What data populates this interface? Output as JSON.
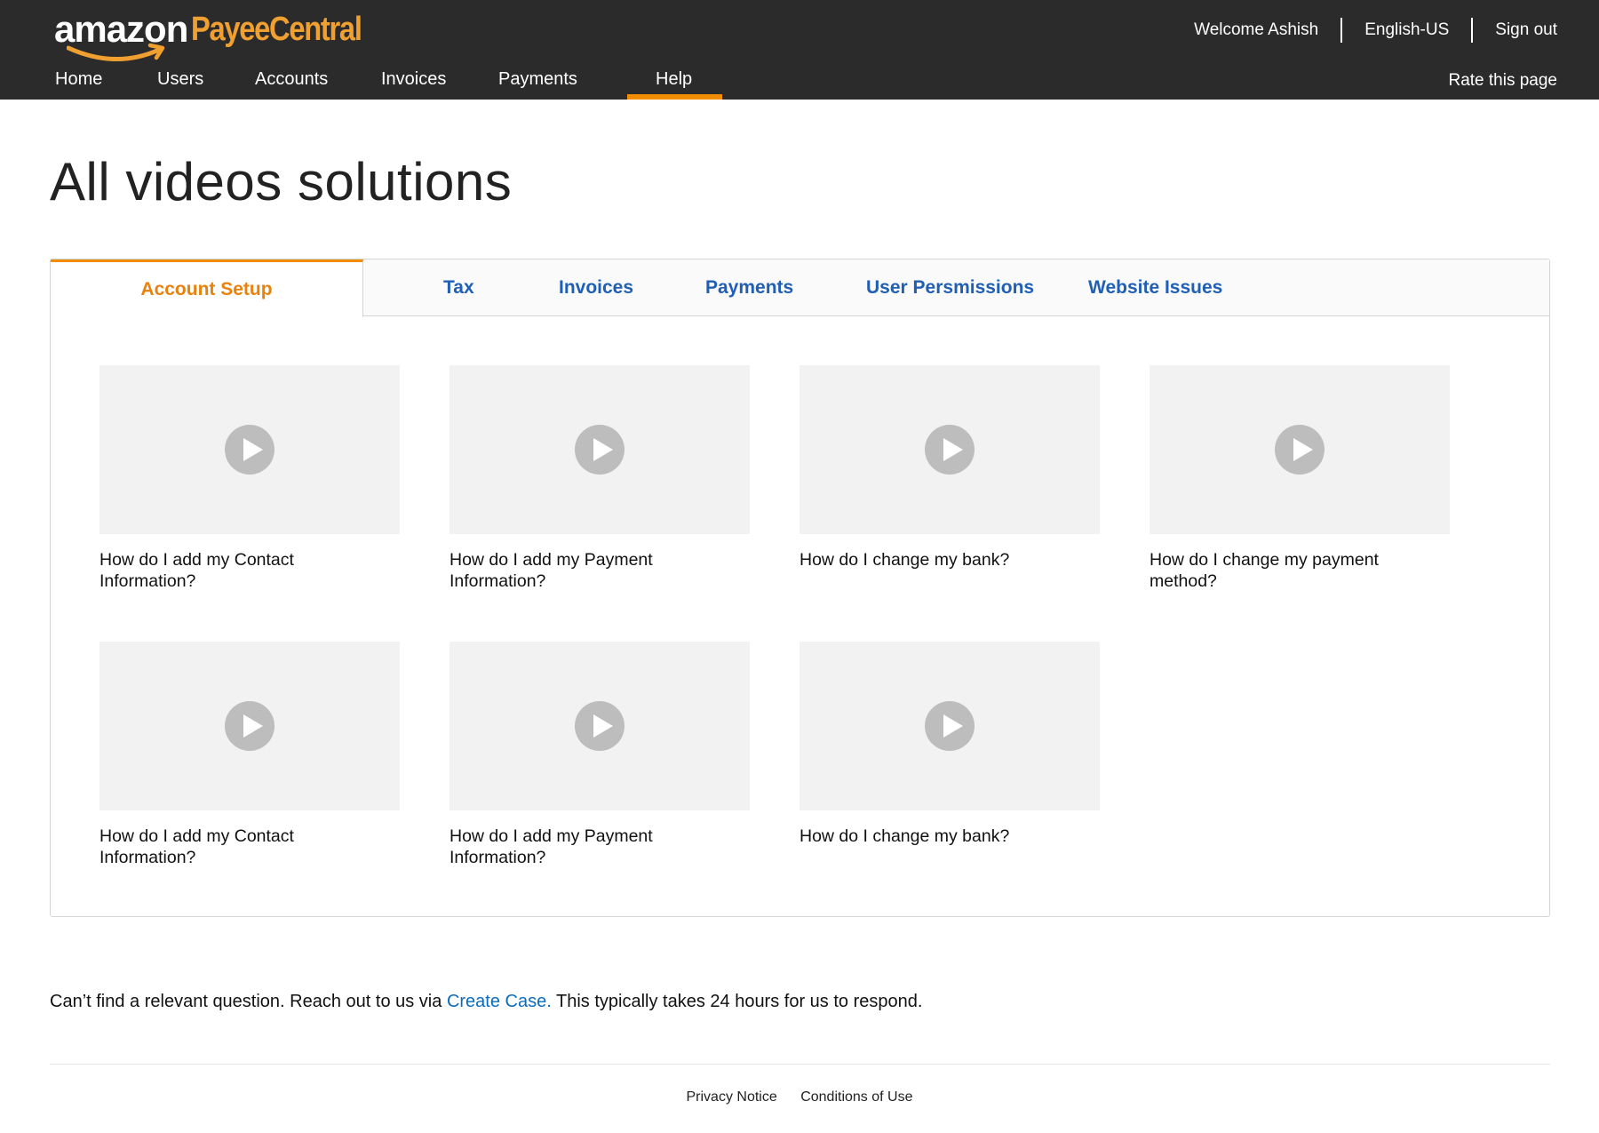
{
  "header": {
    "logo_primary": "amazon",
    "logo_secondary": "PayeeCentral",
    "welcome": "Welcome Ashish",
    "language": "English-US",
    "sign_out": "Sign out",
    "rate_page": "Rate this page"
  },
  "nav": {
    "items": [
      "Home",
      "Users",
      "Accounts",
      "Invoices",
      "Payments",
      "Help"
    ],
    "active": "Help"
  },
  "page": {
    "title": "All videos solutions"
  },
  "tabs": {
    "items": [
      "Account Setup",
      "Tax",
      "Invoices",
      "Payments",
      "User Persmissions",
      "Website Issues"
    ],
    "active": "Account Setup"
  },
  "videos": [
    {
      "title": "How do I add my Contact Information?",
      "icon": "play-icon"
    },
    {
      "title": "How do I add my Payment Information?",
      "icon": "play-icon"
    },
    {
      "title": "How do I change my bank?",
      "icon": "play-icon"
    },
    {
      "title": "How do I change my payment method?",
      "icon": "play-icon"
    },
    {
      "title": "How do I add my Contact Information?",
      "icon": "play-icon"
    },
    {
      "title": "How do I add my Payment Information?",
      "icon": "play-icon"
    },
    {
      "title": "How do I change my bank?",
      "icon": "play-icon"
    }
  ],
  "help_note": {
    "before": "Can’t find a relevant question. Reach out to us via",
    "link": "Create Case.",
    "after": "This typically takes 24 hours for us to respond."
  },
  "footer": {
    "privacy": "Privacy Notice",
    "conditions": "Conditions of Use"
  },
  "colors": {
    "topbar": "#2b2b2b",
    "accent": "#f08c00",
    "tab_link": "#1f5fb5",
    "link": "#0a6cc0"
  }
}
